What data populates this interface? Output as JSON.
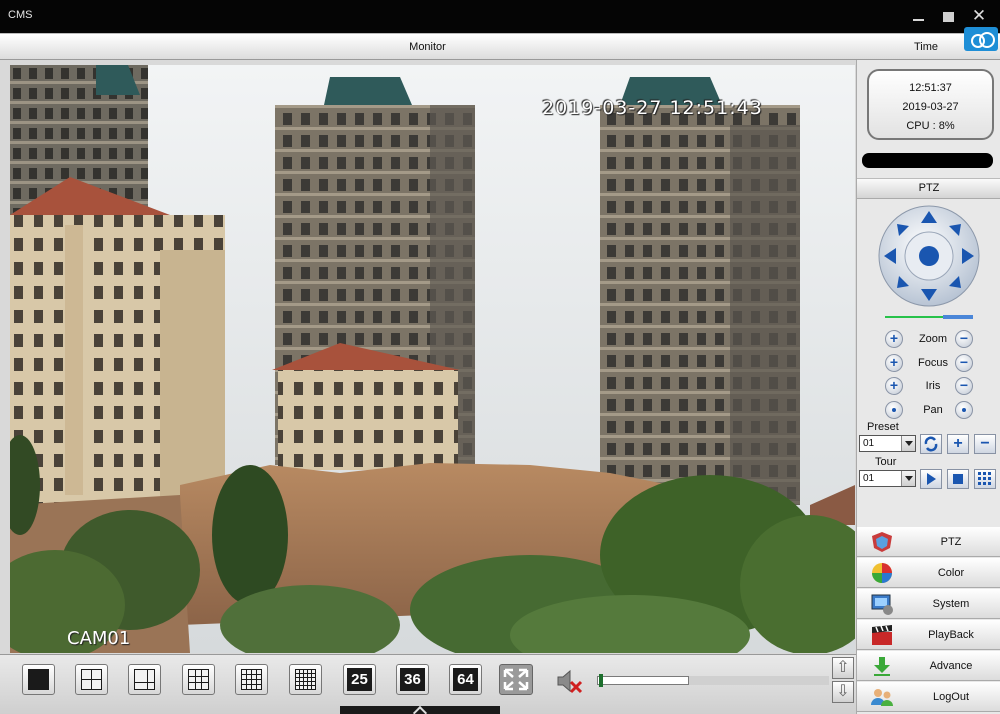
{
  "window": {
    "title": "CMS",
    "close_glyph": "✕"
  },
  "header": {
    "monitor_label": "Monitor",
    "time_label": "Time"
  },
  "video": {
    "osd_timestamp": "2019-03-27 12:51:43",
    "osd_camera": "CAM01"
  },
  "status": {
    "time": "12:51:37",
    "date": "2019-03-27",
    "cpu": "CPU : 8%"
  },
  "ptz": {
    "header": "PTZ",
    "controls": [
      {
        "label": "Zoom"
      },
      {
        "label": "Focus"
      },
      {
        "label": "Iris"
      },
      {
        "label": "Pan"
      }
    ],
    "preset_label": "Preset",
    "preset_value": "01",
    "tour_label": "Tour",
    "tour_value": "01",
    "speed_fraction": 0.66
  },
  "layouts": [
    {
      "name": "layout-1-button"
    },
    {
      "name": "layout-4-button"
    },
    {
      "name": "layout-6-button"
    },
    {
      "name": "layout-9-button"
    },
    {
      "name": "layout-16-button"
    },
    {
      "name": "layout-20-button"
    },
    {
      "name": "layout-25-button",
      "label": "25"
    },
    {
      "name": "layout-36-button",
      "label": "36"
    },
    {
      "name": "layout-64-button",
      "label": "64"
    }
  ],
  "volume": {
    "level_fraction": 0.03
  },
  "menu": [
    {
      "label": "PTZ",
      "icon": "ptz-shield-icon"
    },
    {
      "label": "Color",
      "icon": "color-palette-icon"
    },
    {
      "label": "System",
      "icon": "system-icon"
    },
    {
      "label": "PlayBack",
      "icon": "clapperboard-icon"
    },
    {
      "label": "Advance",
      "icon": "download-arrow-icon"
    },
    {
      "label": "LogOut",
      "icon": "users-icon"
    }
  ],
  "colors": {
    "accent_blue": "#1a56b0",
    "cloud_blue": "#1e8ed6"
  }
}
